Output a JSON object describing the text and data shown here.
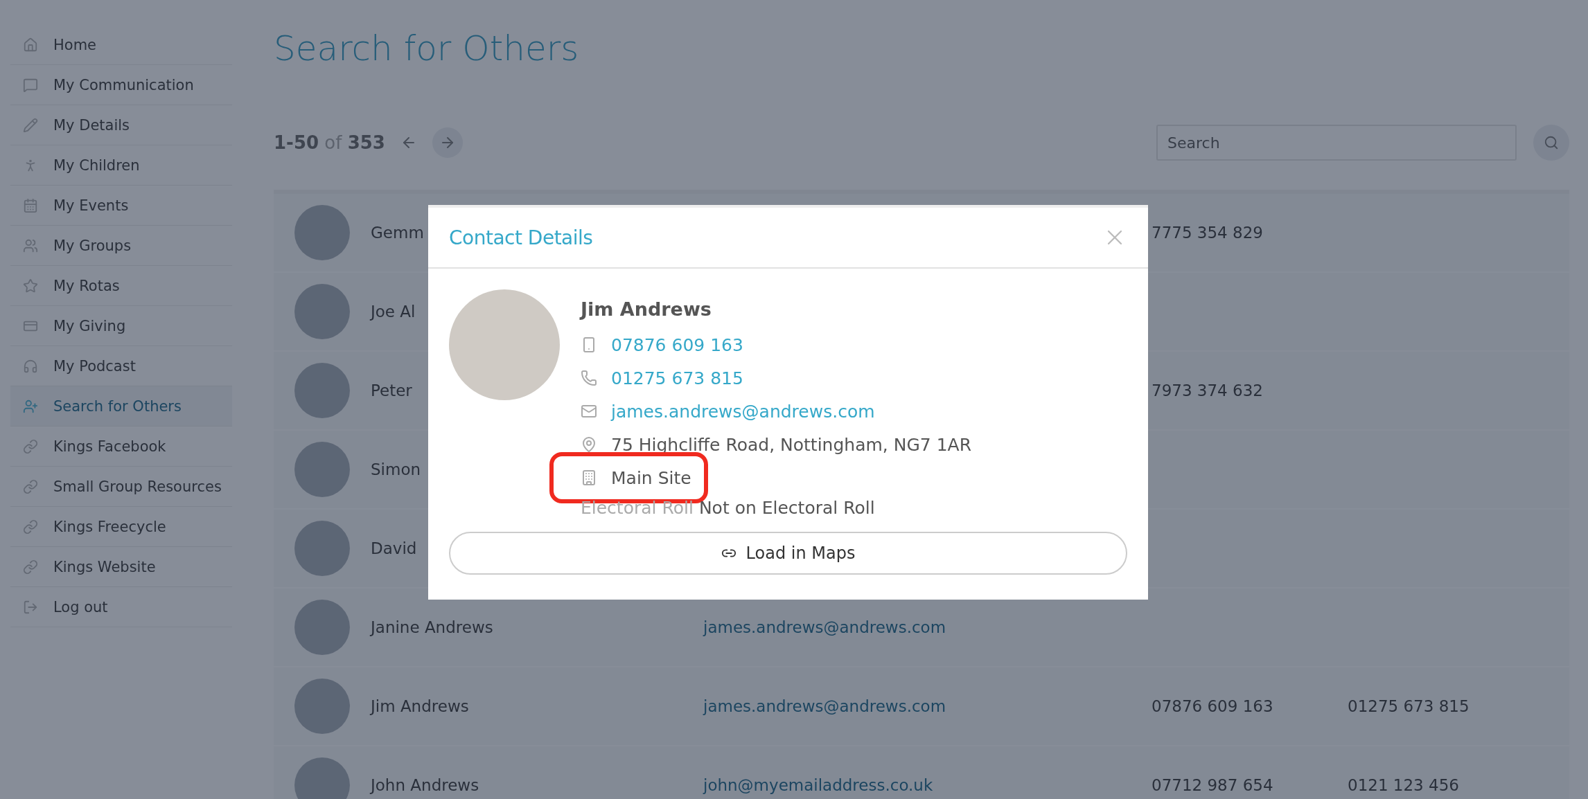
{
  "sidebar": {
    "items": [
      {
        "label": "Home",
        "selected": false
      },
      {
        "label": "My Communication",
        "selected": false
      },
      {
        "label": "My Details",
        "selected": false
      },
      {
        "label": "My Children",
        "selected": false
      },
      {
        "label": "My Events",
        "selected": false
      },
      {
        "label": "My Groups",
        "selected": false
      },
      {
        "label": "My Rotas",
        "selected": false
      },
      {
        "label": "My Giving",
        "selected": false
      },
      {
        "label": "My Podcast",
        "selected": false
      },
      {
        "label": "Search for Others",
        "selected": true
      },
      {
        "label": "Kings Facebook",
        "selected": false
      },
      {
        "label": "Small Group Resources",
        "selected": false
      },
      {
        "label": "Kings Freecycle",
        "selected": false
      },
      {
        "label": "Kings Website",
        "selected": false
      },
      {
        "label": "Log out",
        "selected": false
      }
    ]
  },
  "page_title": "Search for Others",
  "pagination": {
    "range": "**1-50** of **353**"
  },
  "search": {
    "placeholder": "Search"
  },
  "contacts": [
    {
      "name": "Gemm",
      "phone": "7775 354 829"
    },
    {
      "name": "Joe Al"
    },
    {
      "name": "Peter",
      "phone": "7973 374 632"
    },
    {
      "name": "Simon"
    },
    {
      "name": "David"
    },
    {
      "name": "Janine Andrews",
      "email": "james.andrews@andrews.com"
    },
    {
      "name": "Jim Andrews",
      "email": "james.andrews@andrews.com",
      "phone": "07876 609 163",
      "phone_2": "01275 673 815"
    },
    {
      "name": "John Andrews",
      "email": "john@myemailaddress.co.uk",
      "phone": "07712 987 654",
      "phone_2": "0121 123 456"
    }
  ],
  "modal": {
    "title": "Contact Details",
    "name": "Jim Andrews",
    "details": [
      {
        "kind": "mobile",
        "text": "07876 609 163",
        "highlighted": false
      },
      {
        "kind": "phone",
        "text": "01275 673 815",
        "highlighted": false
      },
      {
        "kind": "email",
        "text": "james.andrews@andrews.com",
        "highlighted": false
      },
      {
        "kind": "address",
        "text": "75 Highcliffe Road, Nottingham, NG7 1AR",
        "highlighted": false
      },
      {
        "kind": "site",
        "text": "Main Site",
        "highlighted": true
      }
    ],
    "electoral_roll": {
      "label": "Electoral Roll",
      "value": "Not on Electoral Roll"
    },
    "button": "Load in Maps"
  }
}
